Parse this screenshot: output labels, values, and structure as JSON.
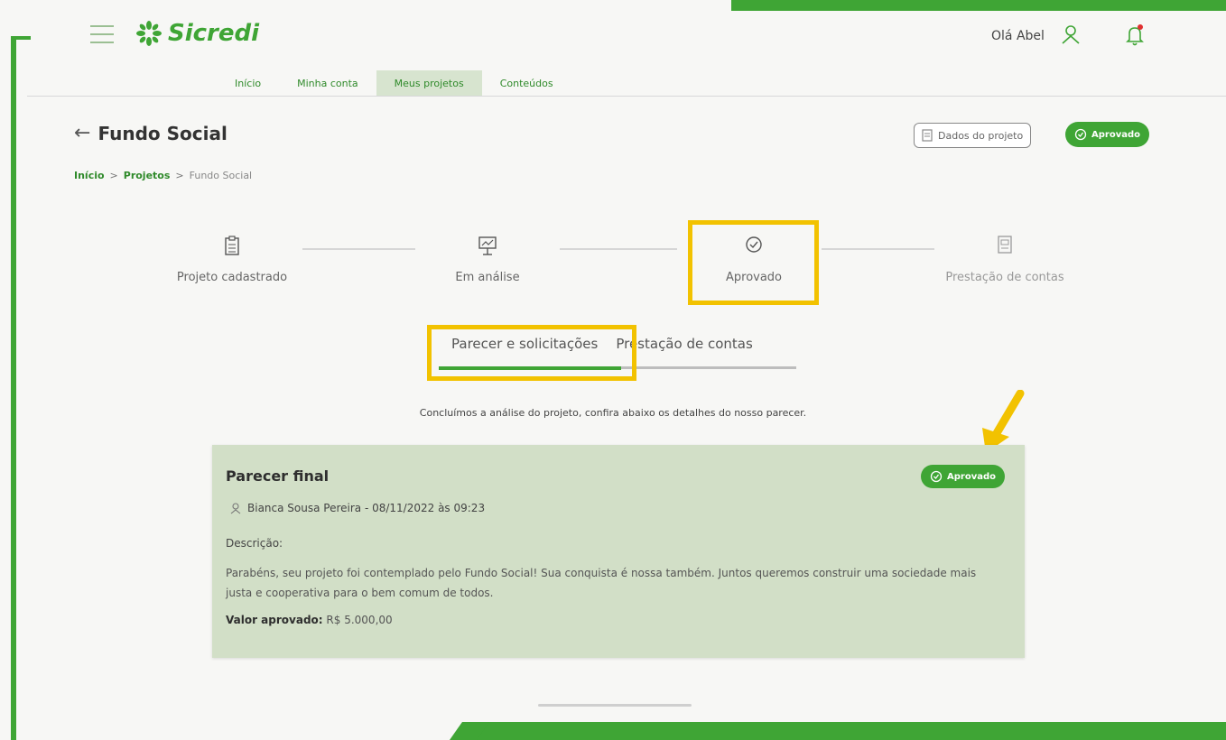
{
  "brand": {
    "name": "Sicredi",
    "accent": "#3fa535",
    "highlight": "#f2c200"
  },
  "header": {
    "greeting": "Olá Abel",
    "user_icon": "user-icon",
    "bell_icon": "bell-icon"
  },
  "nav": {
    "items": [
      {
        "label": "Início",
        "active": false
      },
      {
        "label": "Minha conta",
        "active": false
      },
      {
        "label": "Meus projetos",
        "active": true
      },
      {
        "label": "Conteúdos",
        "active": false
      }
    ]
  },
  "page": {
    "title": "Fundo Social",
    "breadcrumb": [
      "Início",
      "Projetos",
      "Fundo Social"
    ],
    "dados_button": "Dados do projeto",
    "status": "Aprovado"
  },
  "stepper": {
    "steps": [
      {
        "label": "Projeto cadastrado",
        "icon": "clipboard-icon"
      },
      {
        "label": "Em análise",
        "icon": "analysis-board-icon"
      },
      {
        "label": "Aprovado",
        "icon": "check-circle-icon",
        "highlighted": true
      },
      {
        "label": "Prestação de contas",
        "icon": "document-icon"
      }
    ]
  },
  "sub_tabs": {
    "items": [
      {
        "label": "Parecer e solicitações",
        "active": true
      },
      {
        "label": "Prestação de contas",
        "active": false
      }
    ]
  },
  "intro_text": "Concluímos a análise do projeto, confira abaixo os detalhes do nosso parecer.",
  "card": {
    "title": "Parecer final",
    "status": "Aprovado",
    "author": "Bianca Sousa Pereira - 08/11/2022 às 09:23",
    "description_label": "Descrição:",
    "description": "Parabéns, seu projeto foi contemplado pelo Fundo Social! Sua conquista é nossa também. Juntos queremos construir uma sociedade mais justa e cooperativa para o bem comum de todos.",
    "valor_label": "Valor aprovado:",
    "valor": "R$ 5.000,00"
  }
}
